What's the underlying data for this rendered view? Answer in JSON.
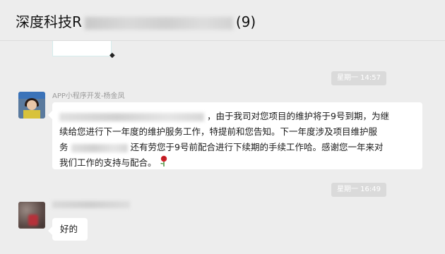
{
  "header": {
    "title_prefix": "深度科技R",
    "title_count": "(9)"
  },
  "messages": [
    {
      "timestamp": "星期一 14:57",
      "sender": "APP小程序开发-杨金凤",
      "lines": [
        "，由于我司对您项目的维护将于9号到期，为继",
        "续给您进行下一年度的维护服务工作，特提前和您告知。下一年度涉及项目维护服",
        "务",
        "还有劳您于9号前配合进行下续期的手续工作哈。感谢您一年来对",
        "我们工作的支持与配合。"
      ],
      "emoji": "rose-icon"
    },
    {
      "timestamp": "星期一 16:49",
      "text": "好的"
    }
  ],
  "colors": {
    "background": "#ededed",
    "bubble": "#ffffff",
    "timestamp_bg": "#dadada"
  }
}
